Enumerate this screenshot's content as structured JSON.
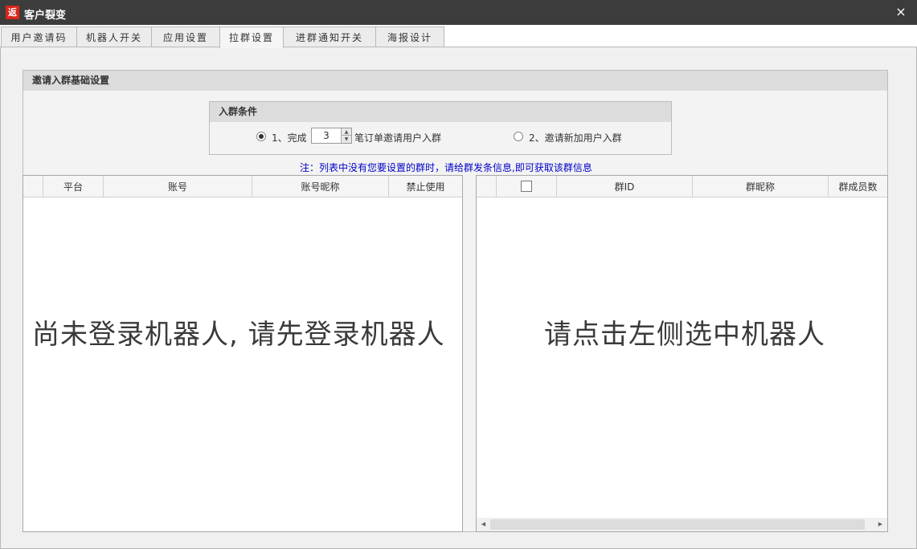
{
  "window": {
    "icon_text": "返",
    "title": "客户裂变",
    "close_label": "×"
  },
  "tabs": [
    {
      "label": "用户邀请码"
    },
    {
      "label": "机器人开关"
    },
    {
      "label": "应用设置"
    },
    {
      "label": "拉群设置",
      "active": true
    },
    {
      "label": "进群通知开关"
    },
    {
      "label": "海报设计"
    }
  ],
  "group": {
    "title": "邀请入群基础设置"
  },
  "condition": {
    "title": "入群条件",
    "option1_prefix": "1、完成",
    "option1_count": "3",
    "option1_suffix": "笔订单邀请用户入群",
    "option2_label": "2、邀请新加用户入群",
    "selected": "option1"
  },
  "note": "注：列表中没有您要设置的群时，请给群发条信息,即可获取该群信息",
  "left_table": {
    "columns": [
      "平台",
      "账号",
      "账号昵称",
      "禁止使用"
    ],
    "empty_message": "尚未登录机器人, 请先登录机器人"
  },
  "right_table": {
    "columns": [
      "群ID",
      "群昵称",
      "群成员数"
    ],
    "empty_message": "请点击左侧选中机器人"
  },
  "scroll": {
    "left_arrow": "◀",
    "right_arrow": "▶"
  },
  "colors": {
    "titlebar": "#3c3c3c",
    "icon_bg": "#d9261c",
    "note": "#0000c8"
  }
}
